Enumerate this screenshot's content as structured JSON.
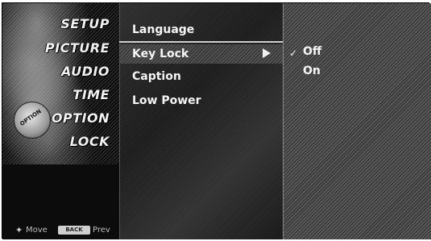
{
  "sidebar": {
    "items": [
      {
        "label": "SETUP"
      },
      {
        "label": "PICTURE"
      },
      {
        "label": "AUDIO"
      },
      {
        "label": "TIME"
      },
      {
        "label": "OPTION"
      },
      {
        "label": "LOCK"
      }
    ],
    "badge_text": "OPTION",
    "hints": {
      "move_icon": "✦",
      "move_label": "Move",
      "back_key": "BACK",
      "prev_label": "Prev"
    }
  },
  "menu": {
    "items": [
      {
        "label": "Language"
      },
      {
        "label": "Key Lock"
      },
      {
        "label": "Caption"
      },
      {
        "label": "Low Power"
      }
    ],
    "selected_index": 1,
    "arrow_icon": "right-arrow-icon"
  },
  "submenu": {
    "options": [
      {
        "label": "Off",
        "checked": true
      },
      {
        "label": "On",
        "checked": false
      }
    ],
    "check_mark": "✓"
  }
}
